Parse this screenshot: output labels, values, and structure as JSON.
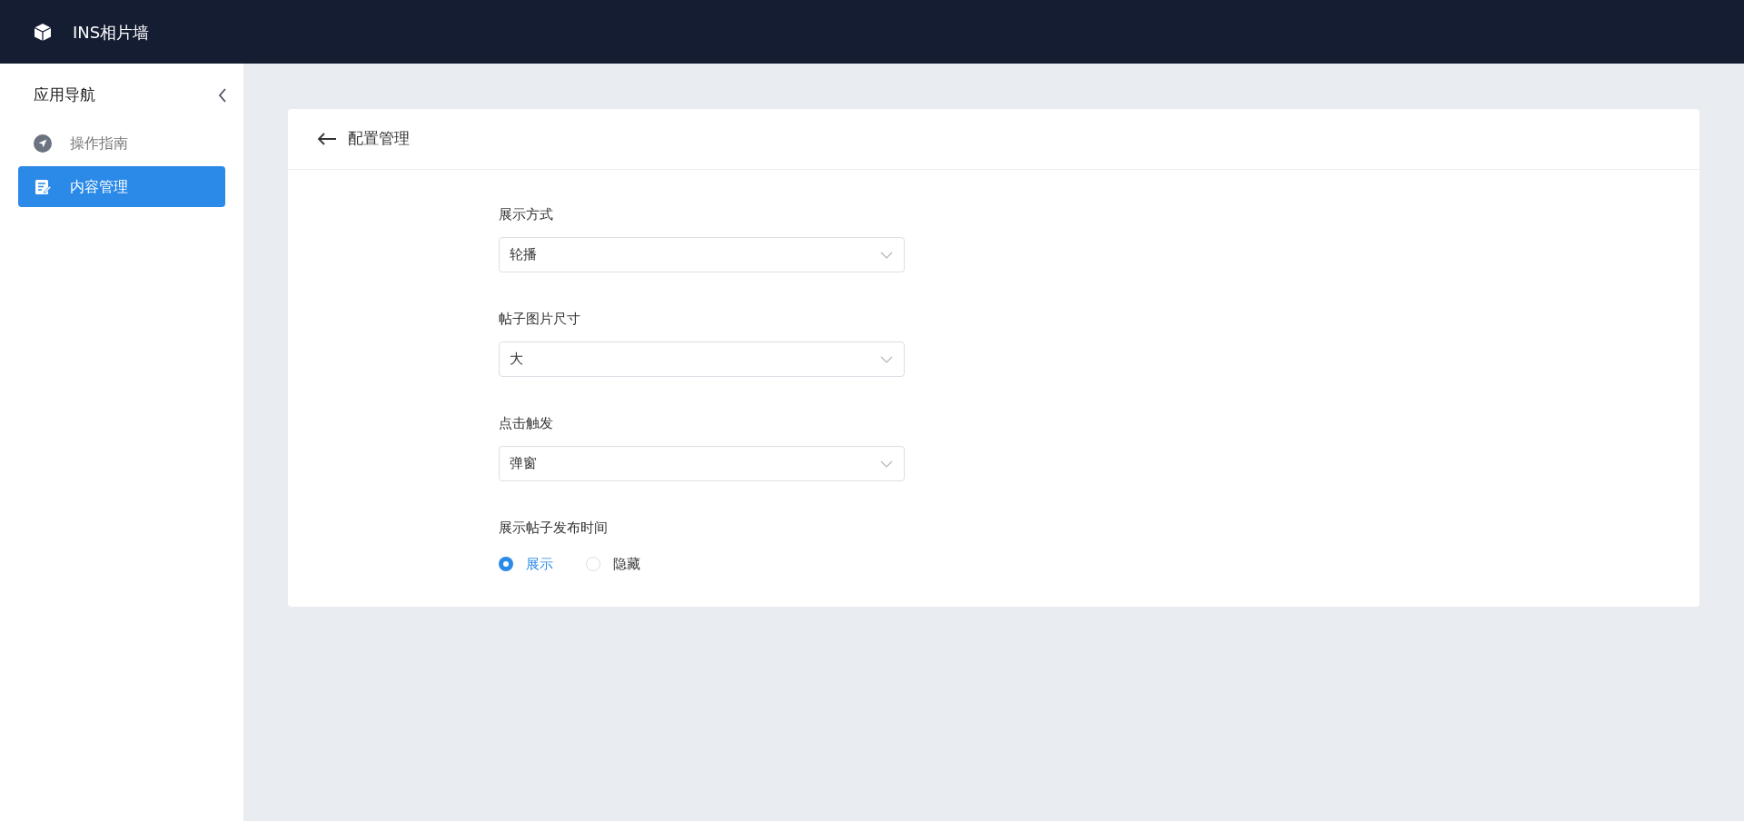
{
  "app_bar": {
    "title": "INS相片墙"
  },
  "sidebar": {
    "title": "应用导航",
    "items": [
      {
        "label": "操作指南",
        "kind": "guide",
        "selected": false
      },
      {
        "label": "内容管理",
        "kind": "content",
        "selected": true
      }
    ]
  },
  "panel": {
    "title": "配置管理",
    "fields": [
      {
        "kind": "select",
        "label": "展示方式",
        "value": "轮播"
      },
      {
        "kind": "select",
        "label": "帖子图片尺寸",
        "value": "大"
      },
      {
        "kind": "select",
        "label": "点击触发",
        "value": "弹窗"
      },
      {
        "kind": "radio",
        "label": "展示帖子发布时间",
        "options": [
          {
            "label": "展示",
            "selected": true
          },
          {
            "label": "隐藏",
            "selected": false
          }
        ]
      }
    ]
  }
}
